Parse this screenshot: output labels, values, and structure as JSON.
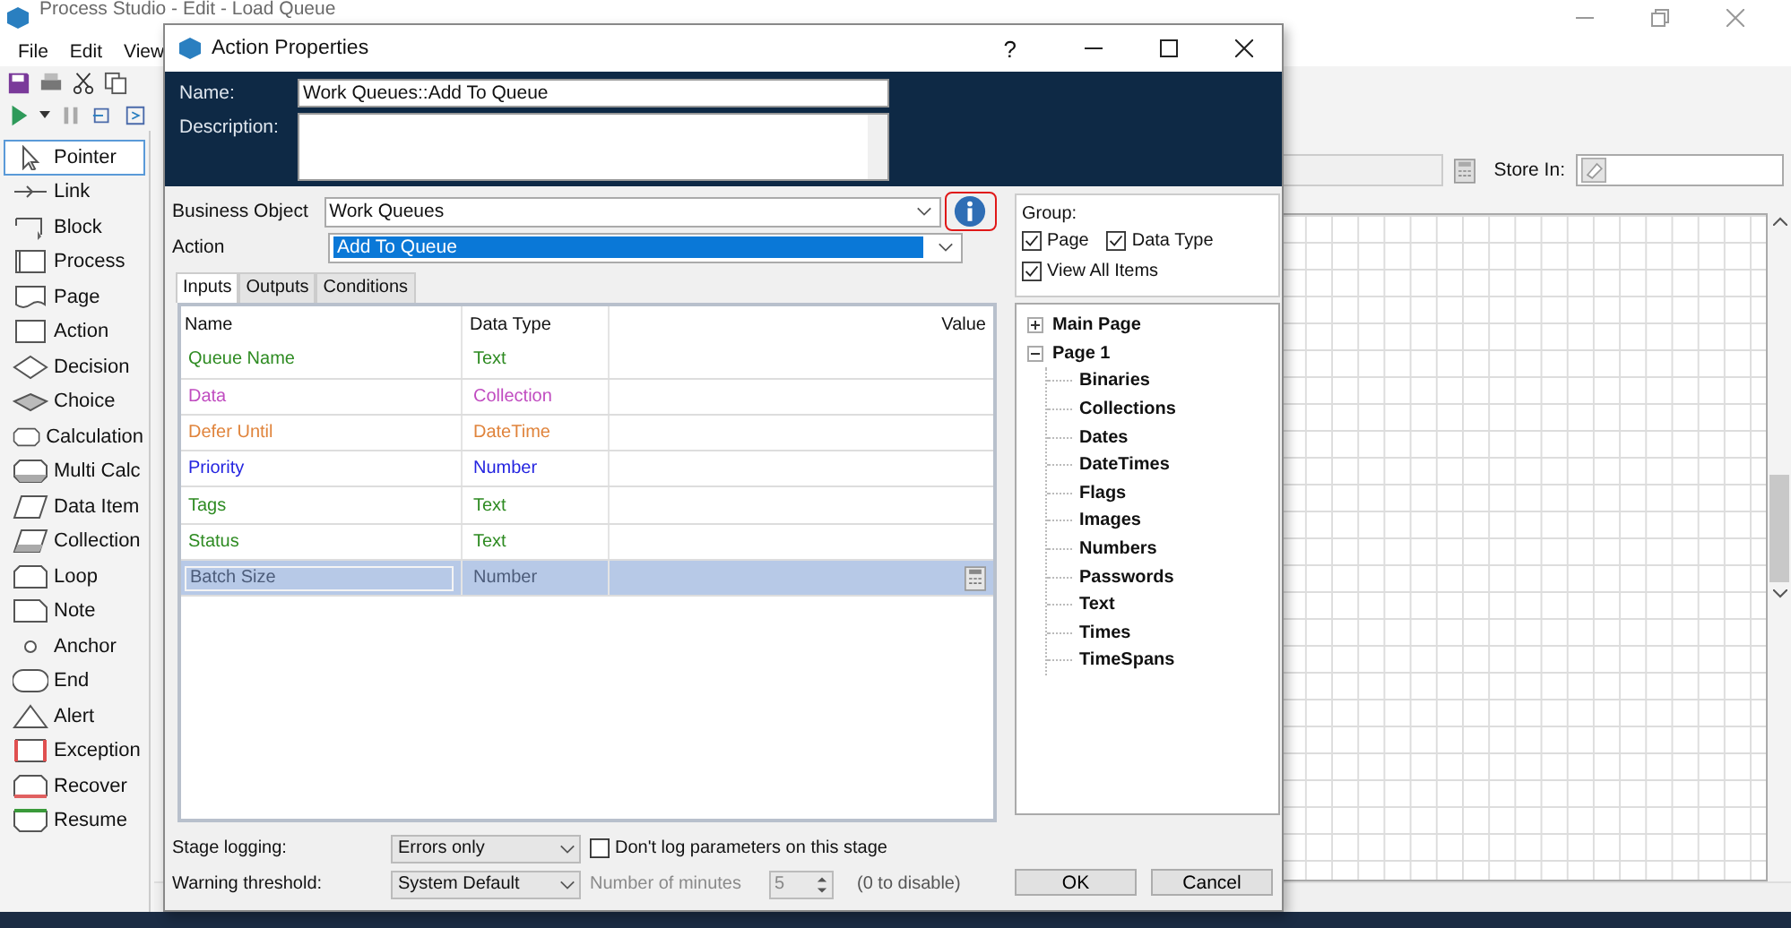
{
  "app": {
    "title": "Process Studio - Edit - Load Queue",
    "menu": [
      "File",
      "Edit",
      "View"
    ],
    "palette": [
      {
        "label": "Pointer",
        "selected": true
      },
      {
        "label": "Link",
        "selected": false
      },
      {
        "label": "Block",
        "selected": false
      },
      {
        "label": "Process",
        "selected": false
      },
      {
        "label": "Page",
        "selected": false
      },
      {
        "label": "Action",
        "selected": false
      },
      {
        "label": "Decision",
        "selected": false
      },
      {
        "label": "Choice",
        "selected": false
      },
      {
        "label": "Calculation",
        "selected": false
      },
      {
        "label": "Multi Calc",
        "selected": false
      },
      {
        "label": "Data Item",
        "selected": false
      },
      {
        "label": "Collection",
        "selected": false
      },
      {
        "label": "Loop",
        "selected": false
      },
      {
        "label": "Note",
        "selected": false
      },
      {
        "label": "Anchor",
        "selected": false
      },
      {
        "label": "End",
        "selected": false
      },
      {
        "label": "Alert",
        "selected": false
      },
      {
        "label": "Exception",
        "selected": false
      },
      {
        "label": "Recover",
        "selected": false
      },
      {
        "label": "Resume",
        "selected": false
      }
    ],
    "store_in_label": "Store In:"
  },
  "dialog": {
    "title": "Action Properties",
    "help": "?",
    "name_label": "Name:",
    "name_value": "Work Queues::Add To Queue",
    "description_label": "Description:",
    "business_object_label": "Business Object",
    "business_object": "Work Queues",
    "action_label": "Action",
    "action": "Add To Queue",
    "tabs": [
      {
        "label": "Inputs",
        "selected": true
      },
      {
        "label": "Outputs",
        "selected": false
      },
      {
        "label": "Conditions",
        "selected": false
      }
    ],
    "table": {
      "columns": [
        "Name",
        "Data Type",
        "Value"
      ],
      "rows": [
        {
          "name": "Queue Name",
          "data_type": "Text",
          "color": "#2e8b22",
          "selected": false
        },
        {
          "name": "Data",
          "data_type": "Collection",
          "color": "#c04cc0",
          "selected": false
        },
        {
          "name": "Defer Until",
          "data_type": "DateTime",
          "color": "#e0843c",
          "selected": false
        },
        {
          "name": "Priority",
          "data_type": "Number",
          "color": "#2424e0",
          "selected": false
        },
        {
          "name": "Tags",
          "data_type": "Text",
          "color": "#2e8b22",
          "selected": false
        },
        {
          "name": "Status",
          "data_type": "Text",
          "color": "#2e8b22",
          "selected": false
        },
        {
          "name": "Batch Size",
          "data_type": "Number",
          "selected": true
        }
      ]
    },
    "group": {
      "label": "Group:",
      "options": [
        {
          "label": "Page",
          "checked": true
        },
        {
          "label": "Data Type",
          "checked": true
        },
        {
          "label": "View All Items",
          "checked": true
        }
      ]
    },
    "tree": [
      {
        "label": "Main Page",
        "expanded": false
      },
      {
        "label": "Page 1",
        "expanded": true,
        "children": [
          {
            "label": "Binaries"
          },
          {
            "label": "Collections"
          },
          {
            "label": "Dates"
          },
          {
            "label": "DateTimes"
          },
          {
            "label": "Flags"
          },
          {
            "label": "Images"
          },
          {
            "label": "Numbers"
          },
          {
            "label": "Passwords"
          },
          {
            "label": "Text"
          },
          {
            "label": "Times"
          },
          {
            "label": "TimeSpans"
          }
        ]
      }
    ],
    "stage_logging": {
      "label": "Stage logging:",
      "value": "Errors only",
      "checkbox": {
        "label": "Don't log parameters on this stage",
        "checked": false
      }
    },
    "warning": {
      "label": "Warning threshold:",
      "value": "System Default",
      "minutes_label": "Number of minutes",
      "minutes": "5",
      "minutes_disabled": true,
      "hint": "(0 to disable)"
    },
    "buttons": [
      "OK",
      "Cancel"
    ]
  }
}
